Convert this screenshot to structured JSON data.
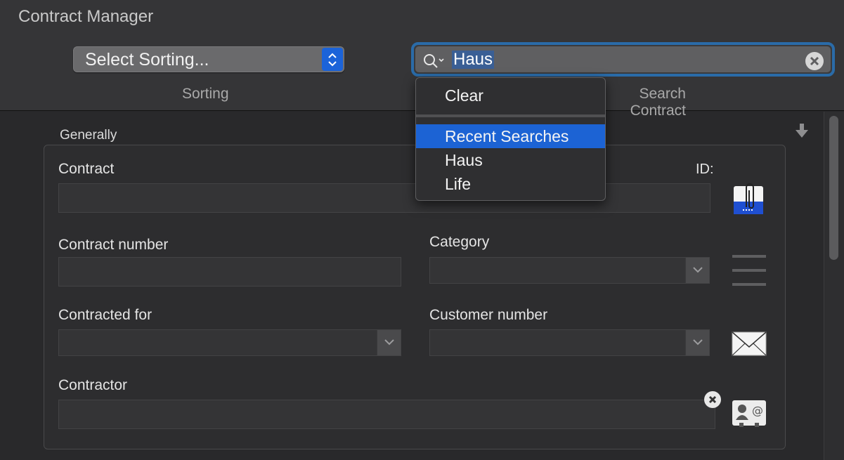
{
  "window": {
    "title": "Contract Manager"
  },
  "toolbar": {
    "sorting": {
      "value": "Select Sorting...",
      "caption": "Sorting"
    },
    "search": {
      "query": "Haus",
      "caption": "Search Contract"
    }
  },
  "search_menu": {
    "clear_label": "Clear",
    "recent_header": "Recent Searches",
    "recent_items": [
      "Haus",
      "Life"
    ]
  },
  "form": {
    "section": "Generally",
    "contract_label": "Contract",
    "id_label": "ID:",
    "contract_number_label": "Contract number",
    "category_label": "Category",
    "contracted_for_label": "Contracted for",
    "customer_number_label": "Customer number",
    "contractor_label": "Contractor"
  },
  "colors": {
    "accent": "#1c63d4",
    "focus_ring": "#2a6ba8"
  }
}
